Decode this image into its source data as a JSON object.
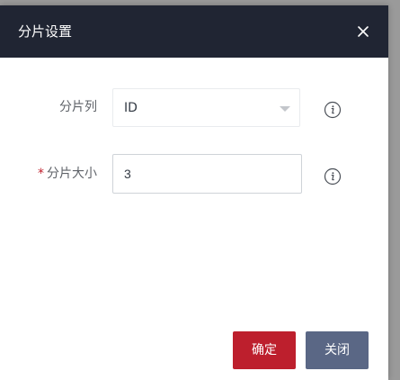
{
  "dialog": {
    "title": "分片设置",
    "close_icon": "close-icon"
  },
  "form": {
    "shard_column": {
      "label": "分片列",
      "value": "ID",
      "info_icon": "info-icon"
    },
    "shard_size": {
      "required_mark": "*",
      "label": "分片大小",
      "value": "3",
      "info_icon": "info-icon"
    }
  },
  "footer": {
    "confirm_label": "确定",
    "close_label": "关闭"
  },
  "colors": {
    "header_bg": "#202533",
    "confirm_bg": "#bd1f2d",
    "close_bg": "#5a6785",
    "required": "#c0212e"
  }
}
